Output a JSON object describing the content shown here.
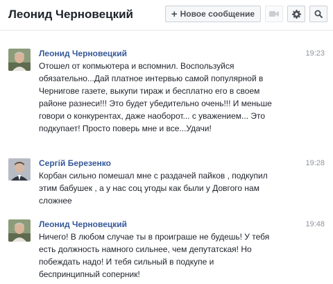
{
  "header": {
    "title": "Леонид Черновецкий",
    "new_message_label": "Новое сообщение",
    "icons": {
      "new_message": "plus-icon",
      "video": "video-camera-icon",
      "settings": "gear-icon",
      "search": "search-icon"
    }
  },
  "messages": [
    {
      "author": "Леонид Черновецкий",
      "time": "19:23",
      "text": "Отошел от копмьютера и вспомнил. Воспользуйся обязательно...Дай платное интервью самой популярной в Чернигове газете, выкупи тираж и бесплатно его в своем районе разнеси!!! Это будет убедительно очень!!! И меньше говори о конкурентах, даже наоборот... с уважением... Это подкупает! Просто поверь мне и все...Удачи!"
    },
    {
      "author": "Сергій Березенко",
      "time": "19:28",
      "text": "Корбан сильно помешал мне с раздачей пайков , подкупил этим бабушек , а у нас соц угоды как были у Довгого нам сложнее"
    },
    {
      "author": "Леонид Черновецкий",
      "time": "19:48",
      "text": "Ничего! В любом случае ты в проиграше не будешь! У тебя есть должность намного сильнее, чем депутатская! Но побеждать надо! И тебя сильный в подкупе и беспринципный соперник!"
    }
  ],
  "colors": {
    "author_link": "#365899",
    "timestamp": "#90949c",
    "text": "#1d2129",
    "border": "#ced0d4"
  }
}
